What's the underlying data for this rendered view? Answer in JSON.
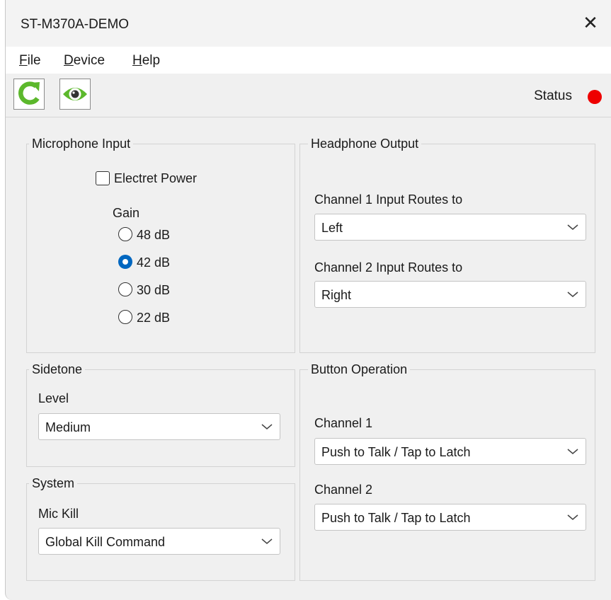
{
  "window": {
    "title": "ST-M370A-DEMO"
  },
  "menu": [
    {
      "accel": "F",
      "rest": "ile"
    },
    {
      "accel": "D",
      "rest": "evice"
    },
    {
      "accel": "H",
      "rest": "elp"
    }
  ],
  "toolbar": {
    "refresh_icon": "refresh-icon",
    "view_icon": "eye-icon",
    "icon_color": "#5cb82c",
    "status_label": "Status",
    "status_color": "#ee0000"
  },
  "microphone": {
    "title": "Microphone Input",
    "electret_label": "Electret Power",
    "electret_checked": false,
    "gain_label": "Gain",
    "gain_options": [
      "48 dB",
      "42 dB",
      "30 dB",
      "22 dB"
    ],
    "gain_selected": "42 dB"
  },
  "headphone": {
    "title": "Headphone Output",
    "ch1_label": "Channel 1 Input Routes to",
    "ch1_value": "Left",
    "ch2_label": "Channel 2 Input Routes to",
    "ch2_value": "Right"
  },
  "sidetone": {
    "title": "Sidetone",
    "level_label": "Level",
    "level_value": "Medium"
  },
  "system": {
    "title": "System",
    "mic_kill_label": "Mic Kill",
    "mic_kill_value": "Global Kill Command"
  },
  "button_operation": {
    "title": "Button Operation",
    "ch1_label": "Channel 1",
    "ch1_value": "Push to Talk / Tap to Latch",
    "ch2_label": "Channel 2",
    "ch2_value": "Push to Talk / Tap to Latch"
  }
}
